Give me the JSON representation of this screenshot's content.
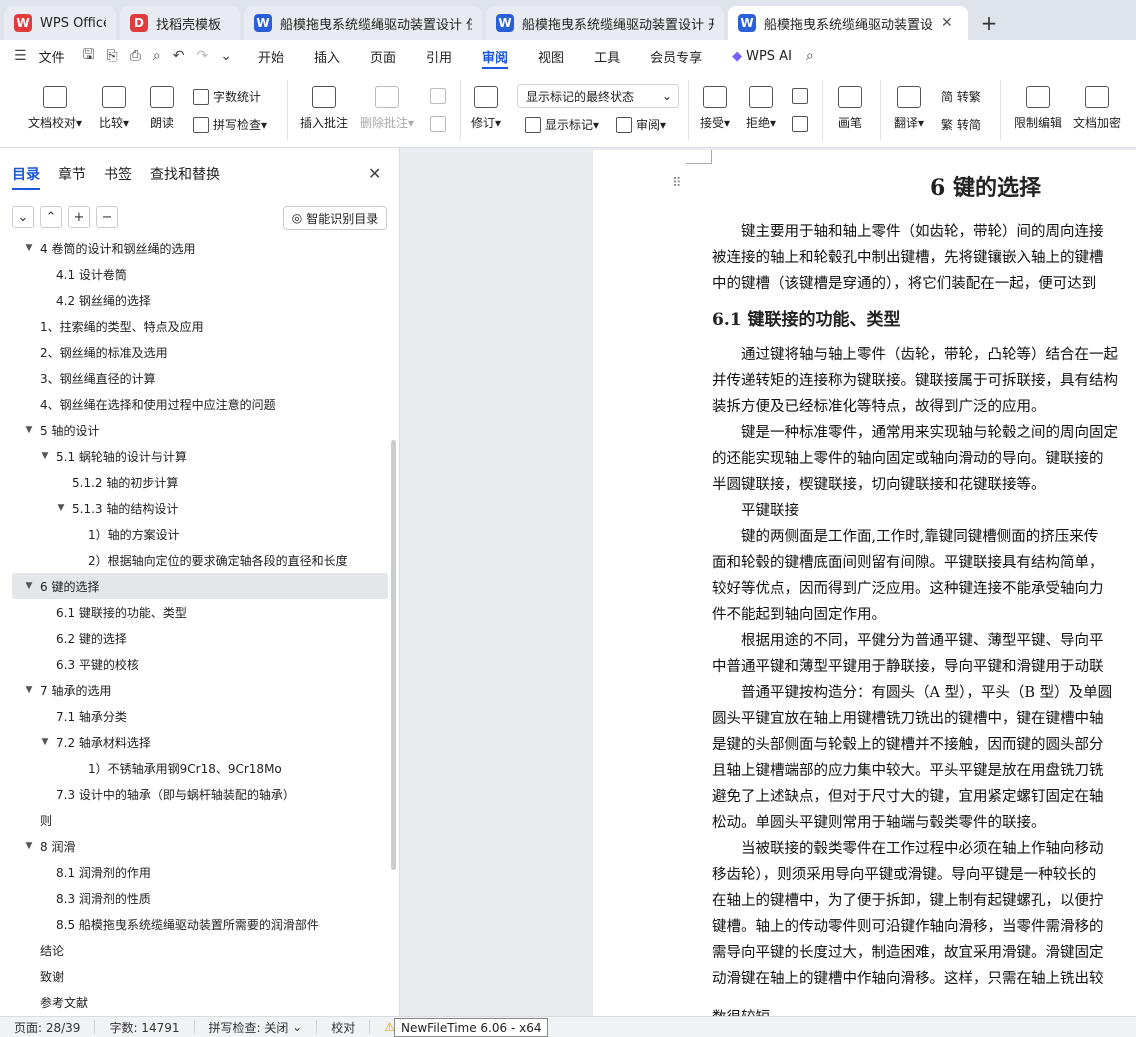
{
  "tabs": [
    {
      "label": "WPS Office",
      "icon": "wps-logo-icon",
      "color": "#e23b3b"
    },
    {
      "label": "找稻壳模板",
      "icon": "docer-icon",
      "color": "#e23b3b"
    },
    {
      "label": "船模拖曳系统缆绳驱动装置设计 任务",
      "icon": "word-doc-icon",
      "color": "#2b5fd9"
    },
    {
      "label": "船模拖曳系统缆绳驱动装置设计 开题",
      "icon": "word-doc-icon",
      "color": "#2b5fd9"
    },
    {
      "label": "船模拖曳系统缆绳驱动装置设",
      "icon": "word-doc-icon",
      "color": "#2b5fd9",
      "active": true
    }
  ],
  "menu": {
    "file": "文件",
    "items": [
      "开始",
      "插入",
      "页面",
      "引用",
      "审阅",
      "视图",
      "工具",
      "会员专享"
    ],
    "active": "审阅",
    "wps_ai": "WPS AI"
  },
  "ribbon": {
    "doc_check": "文档校对",
    "compare": "比较",
    "read_aloud": "朗读",
    "word_count": "字数统计",
    "spell_check": "拼写检查",
    "insert_comment": "插入批注",
    "delete_comment": "删除批注",
    "track_changes": "修订",
    "display_state": "显示标记的最终状态",
    "show_markup": "显示标记",
    "review_pane": "审阅",
    "accept": "接受",
    "reject": "拒绝",
    "pen": "画笔",
    "translate": "翻译",
    "to_traditional": "简 转繁",
    "to_simplified": "繁 转简",
    "restrict_edit": "限制编辑",
    "encrypt": "文档加密"
  },
  "panel": {
    "tabs": [
      "目录",
      "章节",
      "书签",
      "查找和替换"
    ],
    "active_tab": "目录",
    "smart_toc": "智能识别目录",
    "toc": [
      {
        "text": "4  卷筒的设计和钢丝绳的选用",
        "level": 1,
        "arrow": "▼"
      },
      {
        "text": "4.1 设计卷筒",
        "level": 2
      },
      {
        "text": "4.2 钢丝绳的选择",
        "level": 2
      },
      {
        "text": "1、拄索绳的类型、特点及应用",
        "level": 1
      },
      {
        "text": "2、钢丝绳的标准及选用",
        "level": 1
      },
      {
        "text": "3、钢丝绳直径的计算",
        "level": 1
      },
      {
        "text": "4、钢丝绳在选择和使用过程中应注意的问题",
        "level": 1
      },
      {
        "text": "5  轴的设计",
        "level": 1,
        "arrow": "▼"
      },
      {
        "text": "5.1 蜗轮轴的设计与计算",
        "level": 2,
        "arrow": "▼"
      },
      {
        "text": "5.1.2 轴的初步计算",
        "level": 3
      },
      {
        "text": "5.1.3 轴的结构设计",
        "level": 3,
        "arrow": "▼"
      },
      {
        "text": "1）轴的方案设计",
        "level": 4
      },
      {
        "text": "2）根据轴向定位的要求确定轴各段的直径和长度",
        "level": 4
      },
      {
        "text": "6  键的选择",
        "level": 1,
        "arrow": "▼",
        "selected": true
      },
      {
        "text": "6.1 键联接的功能、类型",
        "level": 2
      },
      {
        "text": "6.2 键的选择",
        "level": 2
      },
      {
        "text": "6.3 平键的校核",
        "level": 2
      },
      {
        "text": "7  轴承的选用",
        "level": 1,
        "arrow": "▼"
      },
      {
        "text": "7.1 轴承分类",
        "level": 2
      },
      {
        "text": "7.2 轴承材料选择",
        "level": 2,
        "arrow": "▼"
      },
      {
        "text": "1）不锈轴承用钢9Cr18、9Cr18Mo",
        "level": 4
      },
      {
        "text": "7.3 设计中的轴承（即与蜗杆轴装配的轴承）",
        "level": 2
      },
      {
        "text": "则",
        "level": 1
      },
      {
        "text": "8  润滑",
        "level": 1,
        "arrow": "▼"
      },
      {
        "text": "8.1 润滑剂的作用",
        "level": 2
      },
      {
        "text": "8.3 润滑剂的性质",
        "level": 2
      },
      {
        "text": "8.5 船模拖曳系统缆绳驱动装置所需要的润滑部件",
        "level": 2
      },
      {
        "text": "结论",
        "level": 1
      },
      {
        "text": "致谢",
        "level": 1
      },
      {
        "text": "参考文献",
        "level": 1
      }
    ]
  },
  "doc": {
    "title": "6  键的选择",
    "h2": "6.1 键联接的功能、类型",
    "lines_a": [
      "　　键主要用于轴和轴上零件（如齿轮，带轮）间的周向连接",
      "被连接的轴上和轮毂孔中制出键槽，先将键镶嵌入轴上的键槽",
      "中的键槽（该键槽是穿通的），将它们装配在一起，便可达到"
    ],
    "lines_b": [
      "　　通过键将轴与轴上零件（齿轮，带轮，凸轮等）结合在一起",
      "并传递转矩的连接称为键联接。键联接属于可拆联接，具有结构",
      "装拆方便及已经标准化等特点，故得到广泛的应用。",
      "　　键是一种标准零件，通常用来实现轴与轮毂之间的周向固定",
      "的还能实现轴上零件的轴向固定或轴向滑动的导向。键联接的",
      "半圆键联接，楔键联接，切向键联接和花键联接等。",
      "　　平键联接",
      "　　键的两侧面是工作面,工作时,靠键同键槽侧面的挤压来传",
      "面和轮毂的键槽底面间则留有间隙。平键联接具有结构简单，",
      "较好等优点，因而得到广泛应用。这种键连接不能承受轴向力",
      "件不能起到轴向固定作用。",
      "　　根据用途的不同，平健分为普通平键、薄型平键、导向平",
      "中普通平键和薄型平键用于静联接，导向平键和滑键用于动联",
      "　　普通平键按构造分：有圆头（A 型），平头（B 型）及单圆",
      "圆头平键宜放在轴上用键槽铣刀铣出的键槽中，键在键槽中轴",
      "是键的头部侧面与轮毂上的键槽并不接触，因而键的圆头部分",
      "且轴上键槽端部的应力集中较大。平头平键是放在用盘铣刀铣",
      "避免了上述缺点，但对于尺寸大的键，宜用紧定螺钉固定在轴",
      "松动。单圆头平键则常用于轴端与毂类零件的联接。",
      "　　当被联接的毂类零件在工作过程中必须在轴上作轴向移动",
      "移齿轮），则须采用导向平键或滑键。导向平键是一种较长的",
      "在轴上的键槽中，为了便于拆卸，键上制有起键螺孔，以便拧",
      "键槽。轴上的传动零件则可沿键作轴向滑移，当零件需滑移的",
      "需导向平键的长度过大，制造困难，故宜采用滑键。滑键固定",
      "动滑键在轴上的键槽中作轴向滑移。这样，只需在轴上铣出较",
      "数很较短"
    ]
  },
  "status": {
    "page": "页面: 28/39",
    "words": "字数: 14791",
    "spell": "拼写检查: 关闭",
    "proof": "校对",
    "tooltip": "NewFileTime 6.06 - x64"
  }
}
